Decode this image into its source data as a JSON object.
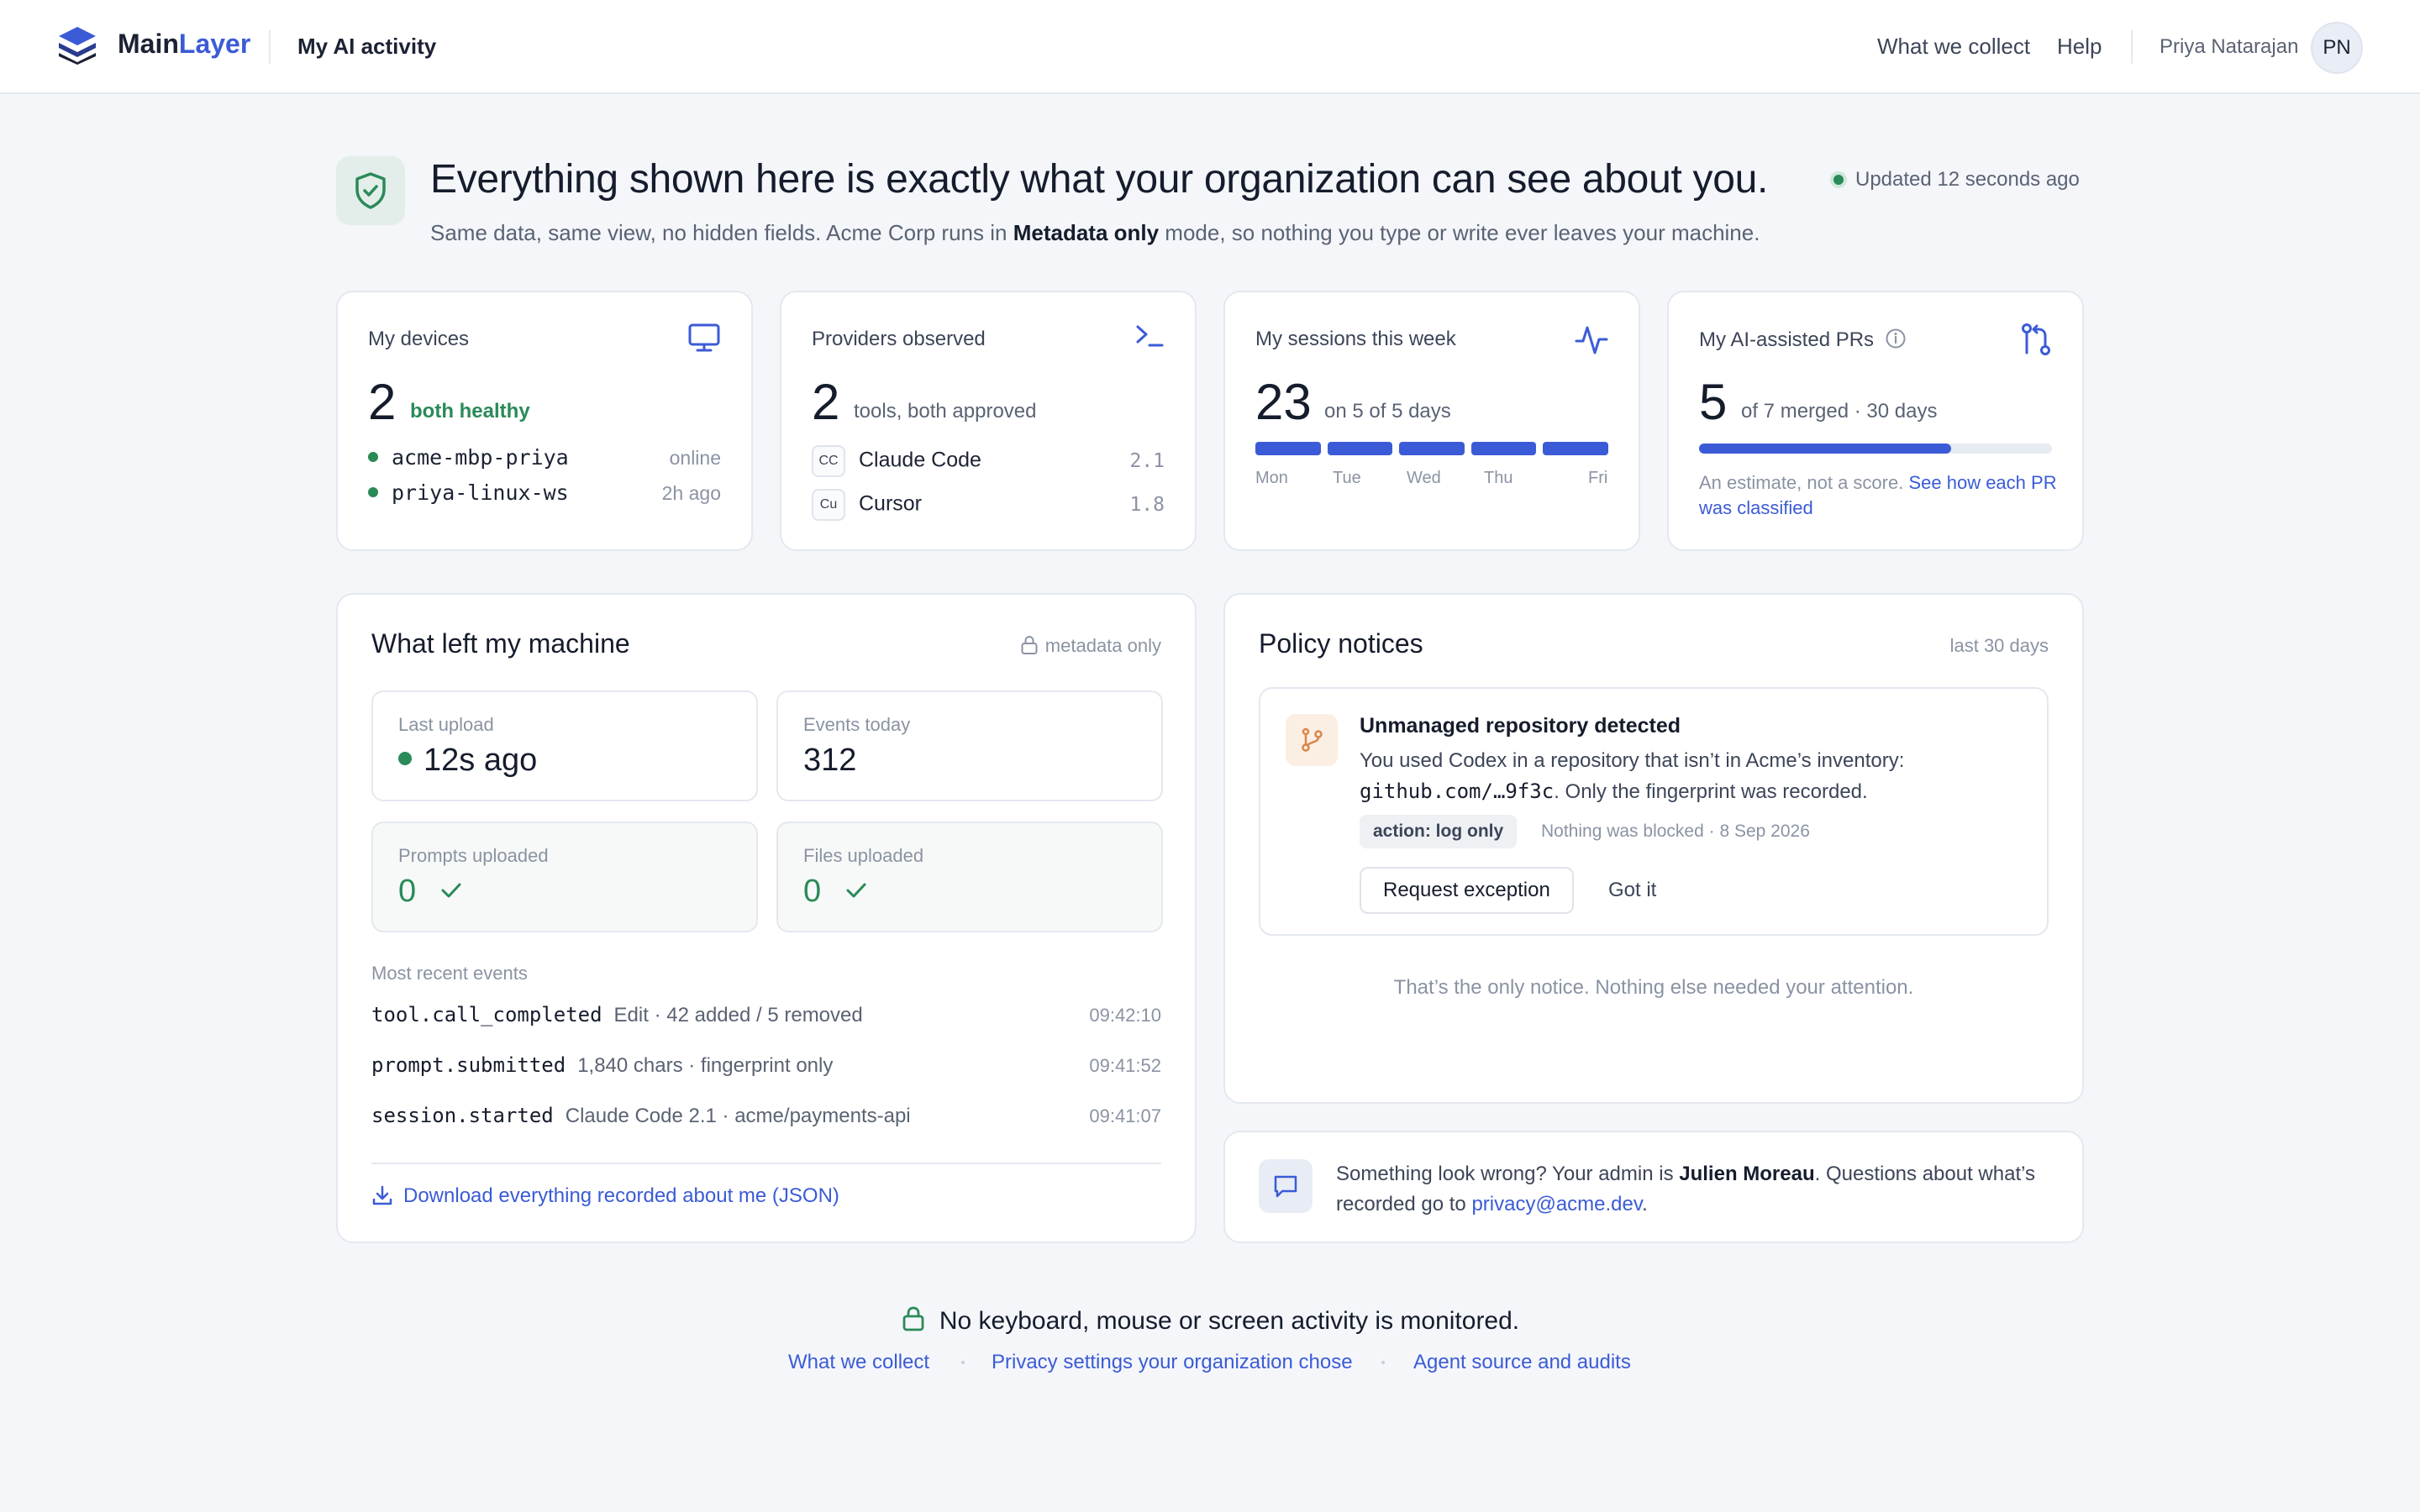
{
  "header": {
    "brand_main": "Main",
    "brand_accent": "Layer",
    "page_title": "My AI activity",
    "links": [
      "What we collect",
      "Help"
    ],
    "user_name": "Priya Natarajan",
    "user_initials": "PN"
  },
  "hero": {
    "title": "Everything shown here is exactly what your organization can see about you.",
    "subtitle_before": "Same data, same view, no hidden fields. Acme Corp runs in ",
    "subtitle_bold": "Metadata only",
    "subtitle_after": " mode, so nothing you type or write ever leaves your machine.",
    "updated": "Updated 12 seconds ago"
  },
  "devices": {
    "label": "My devices",
    "count": "2",
    "note": "both healthy",
    "items": [
      {
        "name": "acme-mbp-priya",
        "status": "online"
      },
      {
        "name": "priya-linux-ws",
        "status": "2h ago"
      }
    ]
  },
  "providers": {
    "label": "Providers observed",
    "count": "2",
    "note": "tools, both approved",
    "items": [
      {
        "tag": "CC",
        "name": "Claude Code",
        "version": "2.1"
      },
      {
        "tag": "Cu",
        "name": "Cursor",
        "version": "1.8"
      }
    ]
  },
  "sessions": {
    "label": "My sessions this week",
    "count": "23",
    "note": "on 5 of 5 days",
    "days": [
      "Mon",
      "Tue",
      "Wed",
      "Thu",
      "Fri"
    ],
    "active_days": 5
  },
  "prs": {
    "label": "My AI-assisted PRs",
    "count": "5",
    "note": "of 7 merged · 30 days",
    "ratio": 0.714,
    "estimate_text": "An estimate, not a score. ",
    "estimate_link": "See how each PR was classified"
  },
  "machine": {
    "title": "What left my machine",
    "badge": "metadata only",
    "stats": [
      {
        "label": "Last upload",
        "value": "12s ago"
      },
      {
        "label": "Events today",
        "value": "312"
      },
      {
        "label": "Prompts uploaded",
        "value": "0"
      },
      {
        "label": "Files uploaded",
        "value": "0"
      }
    ],
    "events_heading": "Most recent events",
    "events": [
      {
        "name": "tool.call_completed",
        "desc": "Edit · 42 added / 5 removed",
        "time": "09:42:10"
      },
      {
        "name": "prompt.submitted",
        "desc": "1,840 chars · fingerprint only",
        "time": "09:41:52"
      },
      {
        "name": "session.started",
        "desc": "Claude Code 2.1 · acme/payments-api",
        "time": "09:41:07"
      }
    ],
    "download": "Download everything recorded about me (JSON)"
  },
  "policy": {
    "title": "Policy notices",
    "range": "last 30 days",
    "notice": {
      "title": "Unmanaged repository detected",
      "body_before": "You used Codex in a repository that isn’t in Acme’s inventory: ",
      "body_code": "github.com/…9f3c",
      "body_after": ". Only the fingerprint was recorded.",
      "action": "action: log only",
      "meta": "Nothing was blocked · 8 Sep 2026",
      "primary": "Request exception",
      "secondary": "Got it"
    },
    "footer": "That’s the only notice. Nothing else needed your attention."
  },
  "help": {
    "before": "Something look wrong? Your admin is ",
    "admin": "Julien Moreau",
    "middle": ". Questions about what’s recorded go to ",
    "email": "privacy@acme.dev",
    "after": "."
  },
  "footer": {
    "statement": "No keyboard, mouse or screen activity is monitored.",
    "links": [
      "What we collect",
      "Privacy settings your organization chose",
      "Agent source and audits"
    ]
  },
  "colors": {
    "accent": "#3b5bd6",
    "success": "#2a8a58",
    "warning": "#d9864a"
  }
}
